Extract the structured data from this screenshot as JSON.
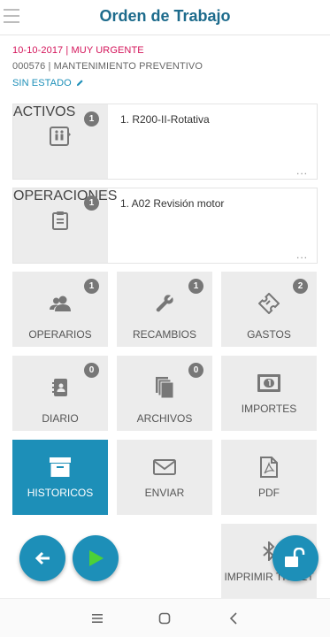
{
  "header": {
    "title": "Orden de Trabajo"
  },
  "info": {
    "date_priority": "10-10-2017 | MUY URGENTE",
    "code_type": "000576 | MANTENIMIENTO PREVENTIVO",
    "status": "SIN ESTADO"
  },
  "activos": {
    "label": "ACTIVOS",
    "count": "1",
    "item": "1. R200-II-Rotativa",
    "more": "..."
  },
  "operaciones": {
    "label": "OPERACIONES",
    "count": "1",
    "item": "1. A02 Revisión motor",
    "more": "..."
  },
  "tiles": {
    "operarios": {
      "label": "OPERARIOS",
      "count": "1"
    },
    "recambios": {
      "label": "RECAMBIOS",
      "count": "1"
    },
    "gastos": {
      "label": "GASTOS",
      "count": "2"
    },
    "diario": {
      "label": "DIARIO",
      "count": "0"
    },
    "archivos": {
      "label": "ARCHIVOS",
      "count": "0"
    },
    "importes": {
      "label": "IMPORTES"
    },
    "historicos": {
      "label": "HISTORICOS"
    },
    "enviar": {
      "label": "ENVIAR"
    },
    "pdf": {
      "label": "PDF"
    },
    "imprimir": {
      "label": "IMPRIMIR TICKET"
    }
  },
  "colors": {
    "accent": "#1d8fb8",
    "title": "#1d6b8c",
    "urgent": "#d4145a",
    "tile_bg": "#ececec"
  },
  "icons": [
    "menu-icon",
    "pencil-icon",
    "elevator-icon",
    "clipboard-icon",
    "users-icon",
    "wrench-icon",
    "ticket-icon",
    "contacts-book-icon",
    "files-icon",
    "banknote-icon",
    "archive-box-icon",
    "envelope-icon",
    "pdf-file-icon",
    "bluetooth-icon",
    "arrow-left-icon",
    "play-icon",
    "unlock-icon",
    "recents-icon",
    "home-icon",
    "back-icon"
  ]
}
